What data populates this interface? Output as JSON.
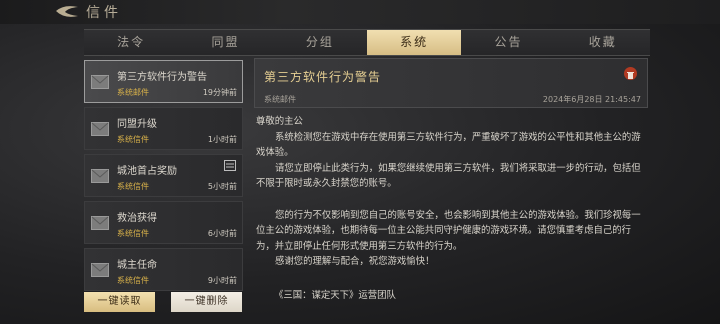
{
  "header": {
    "title": "信件"
  },
  "tabs": [
    "法令",
    "同盟",
    "分组",
    "系统",
    "公告",
    "收藏"
  ],
  "active_tab": "系统",
  "mail_list": [
    {
      "title": "第三方软件行为警告",
      "source": "系统邮件",
      "time": "19分钟前"
    },
    {
      "title": "同盟升级",
      "source": "系统信件",
      "time": "1小时前"
    },
    {
      "title": "城池首占奖励",
      "source": "系统信件",
      "time": "5小时前"
    },
    {
      "title": "救治获得",
      "source": "系统信件",
      "time": "6小时前"
    },
    {
      "title": "城主任命",
      "source": "系统信件",
      "time": "9小时前"
    }
  ],
  "buttons": {
    "read_all": "一键读取",
    "delete_all": "一键删除"
  },
  "detail": {
    "title": "第三方软件行为警告",
    "sender": "系统邮件",
    "date": "2024年6月28日 21:45:47",
    "greeting": "尊敬的主公",
    "p1": "系统检测您在游戏中存在使用第三方软件行为，严重破坏了游戏的公平性和其他主公的游戏体验。",
    "p2": "请您立即停止此类行为，如果您继续使用第三方软件，我们将采取进一步的行动，包括但不限于限时或永久封禁您的账号。",
    "p3": "您的行为不仅影响到您自己的账号安全，也会影响到其他主公的游戏体验。我们珍视每一位主公的游戏体验，也期待每一位主公能共同守护健康的游戏环境。请您慎重考虑自己的行为，并立即停止任何形式使用第三方软件的行为。",
    "p4": "感谢您的理解与配合，祝您游戏愉快！",
    "signature": "《三国：谋定天下》运营团队"
  },
  "colors": {
    "accent": "#d6bd84",
    "source_text": "#d9b24a",
    "title_text": "#e6cf93",
    "delete": "#b13a22"
  },
  "icons": [
    "back-arrow-icon",
    "envelope-icon",
    "document-icon",
    "trash-icon"
  ]
}
